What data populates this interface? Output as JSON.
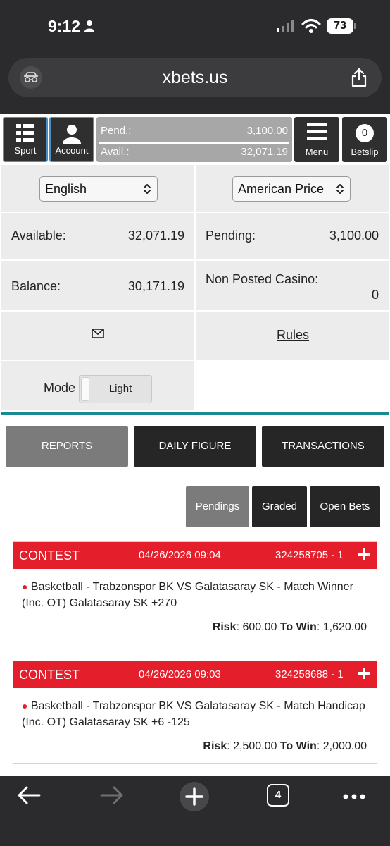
{
  "status": {
    "time": "9:12",
    "battery": "73"
  },
  "browser": {
    "url": "xbets.us",
    "tabs_count": "4"
  },
  "nav": {
    "sport_label": "Sport",
    "account_label": "Account",
    "pending_label": "Pend.:",
    "pending_value": "3,100.00",
    "available_label": "Avail.:",
    "available_value": "32,071.19",
    "menu_label": "Menu",
    "betslip_count": "0",
    "betslip_label": "Betslip"
  },
  "account": {
    "language_value": "English",
    "price_format_value": "American Price",
    "available_label": "Available:",
    "available_value": "32,071.19",
    "pending_label": "Pending:",
    "pending_value": "3,100.00",
    "balance_label": "Balance:",
    "balance_value": "30,171.19",
    "casino_label": "Non Posted Casino:",
    "casino_value": "0",
    "rules_label": "Rules",
    "mode_label": "Mode",
    "mode_value": "Light"
  },
  "tabs": {
    "reports": "REPORTS",
    "daily_figure": "DAILY FIGURE",
    "transactions": "TRANSACTIONS"
  },
  "subtabs": {
    "pendings": "Pendings",
    "graded": "Graded",
    "open_bets": "Open Bets"
  },
  "bets": [
    {
      "type": "CONTEST",
      "date": "04/26/2026 09:04",
      "ticket": "324258705 - 1",
      "description": "Basketball - Trabzonspor BK VS Galatasaray SK - Match Winner (Inc. OT) Galatasaray SK +270",
      "risk_label": "Risk",
      "risk": "600.00",
      "towin_label": "To Win",
      "towin": "1,620.00"
    },
    {
      "type": "CONTEST",
      "date": "04/26/2026 09:03",
      "ticket": "324258688 - 1",
      "description": "Basketball - Trabzonspor BK VS Galatasaray SK - Match Handicap (Inc. OT) Galatasaray SK +6 -125",
      "risk_label": "Risk",
      "risk": "2,500.00",
      "towin_label": "To Win",
      "towin": "2,000.00"
    }
  ],
  "colors": {
    "accent_red": "#e41e2a",
    "teal": "#1b8a93",
    "dark": "#262626",
    "grey": "#7b7b7b"
  }
}
